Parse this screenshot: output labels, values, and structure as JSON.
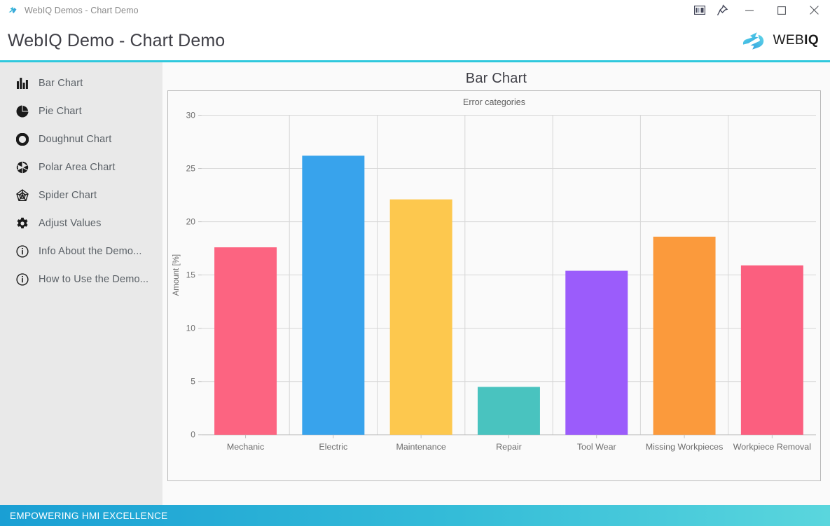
{
  "window": {
    "app_icon": "webiq-logo-icon",
    "title": "WebIQ Demos - Chart Demo",
    "controls": [
      {
        "name": "layout-panel-icon",
        "label": "Panel"
      },
      {
        "name": "pin-icon",
        "label": "Pin"
      },
      {
        "name": "minimize-icon",
        "label": "Minimize"
      },
      {
        "name": "maximize-icon",
        "label": "Maximize"
      },
      {
        "name": "close-icon",
        "label": "Close"
      }
    ]
  },
  "header": {
    "title": "WebIQ Demo - Chart Demo",
    "logo_text_regular": "WEB",
    "logo_text_bold": "IQ",
    "accent_color": "#2fc8dd"
  },
  "sidebar": {
    "items": [
      {
        "label": "Bar Chart",
        "icon": "bar-chart-icon"
      },
      {
        "label": "Pie Chart",
        "icon": "pie-chart-icon"
      },
      {
        "label": "Doughnut Chart",
        "icon": "doughnut-chart-icon"
      },
      {
        "label": "Polar Area Chart",
        "icon": "polar-area-chart-icon"
      },
      {
        "label": "Spider Chart",
        "icon": "spider-chart-icon"
      },
      {
        "label": "Adjust Values",
        "icon": "gear-icon"
      },
      {
        "label": "Info About the Demo...",
        "icon": "info-icon"
      },
      {
        "label": "How to Use the Demo...",
        "icon": "info-icon"
      }
    ]
  },
  "main": {
    "page_title": "Bar Chart"
  },
  "footer": {
    "text": "EMPOWERING HMI EXCELLENCE"
  },
  "chart_data": {
    "type": "bar",
    "title": "Error categories",
    "xlabel": "",
    "ylabel": "Amount [%]",
    "ylim": [
      0,
      30
    ],
    "yticks": [
      0,
      5,
      10,
      15,
      20,
      25,
      30
    ],
    "grid": true,
    "legend": false,
    "categories": [
      "Mechanic",
      "Electric",
      "Maintenance",
      "Repair",
      "Tool Wear",
      "Missing Workpieces",
      "Workpiece Removal"
    ],
    "values": [
      17.6,
      26.2,
      22.1,
      4.5,
      15.4,
      18.6,
      15.9
    ],
    "colors": [
      "#fc6481",
      "#38a3ec",
      "#fdc84e",
      "#49c3bf",
      "#9b5cfb",
      "#fb9a3c",
      "#fb5f7f"
    ]
  }
}
